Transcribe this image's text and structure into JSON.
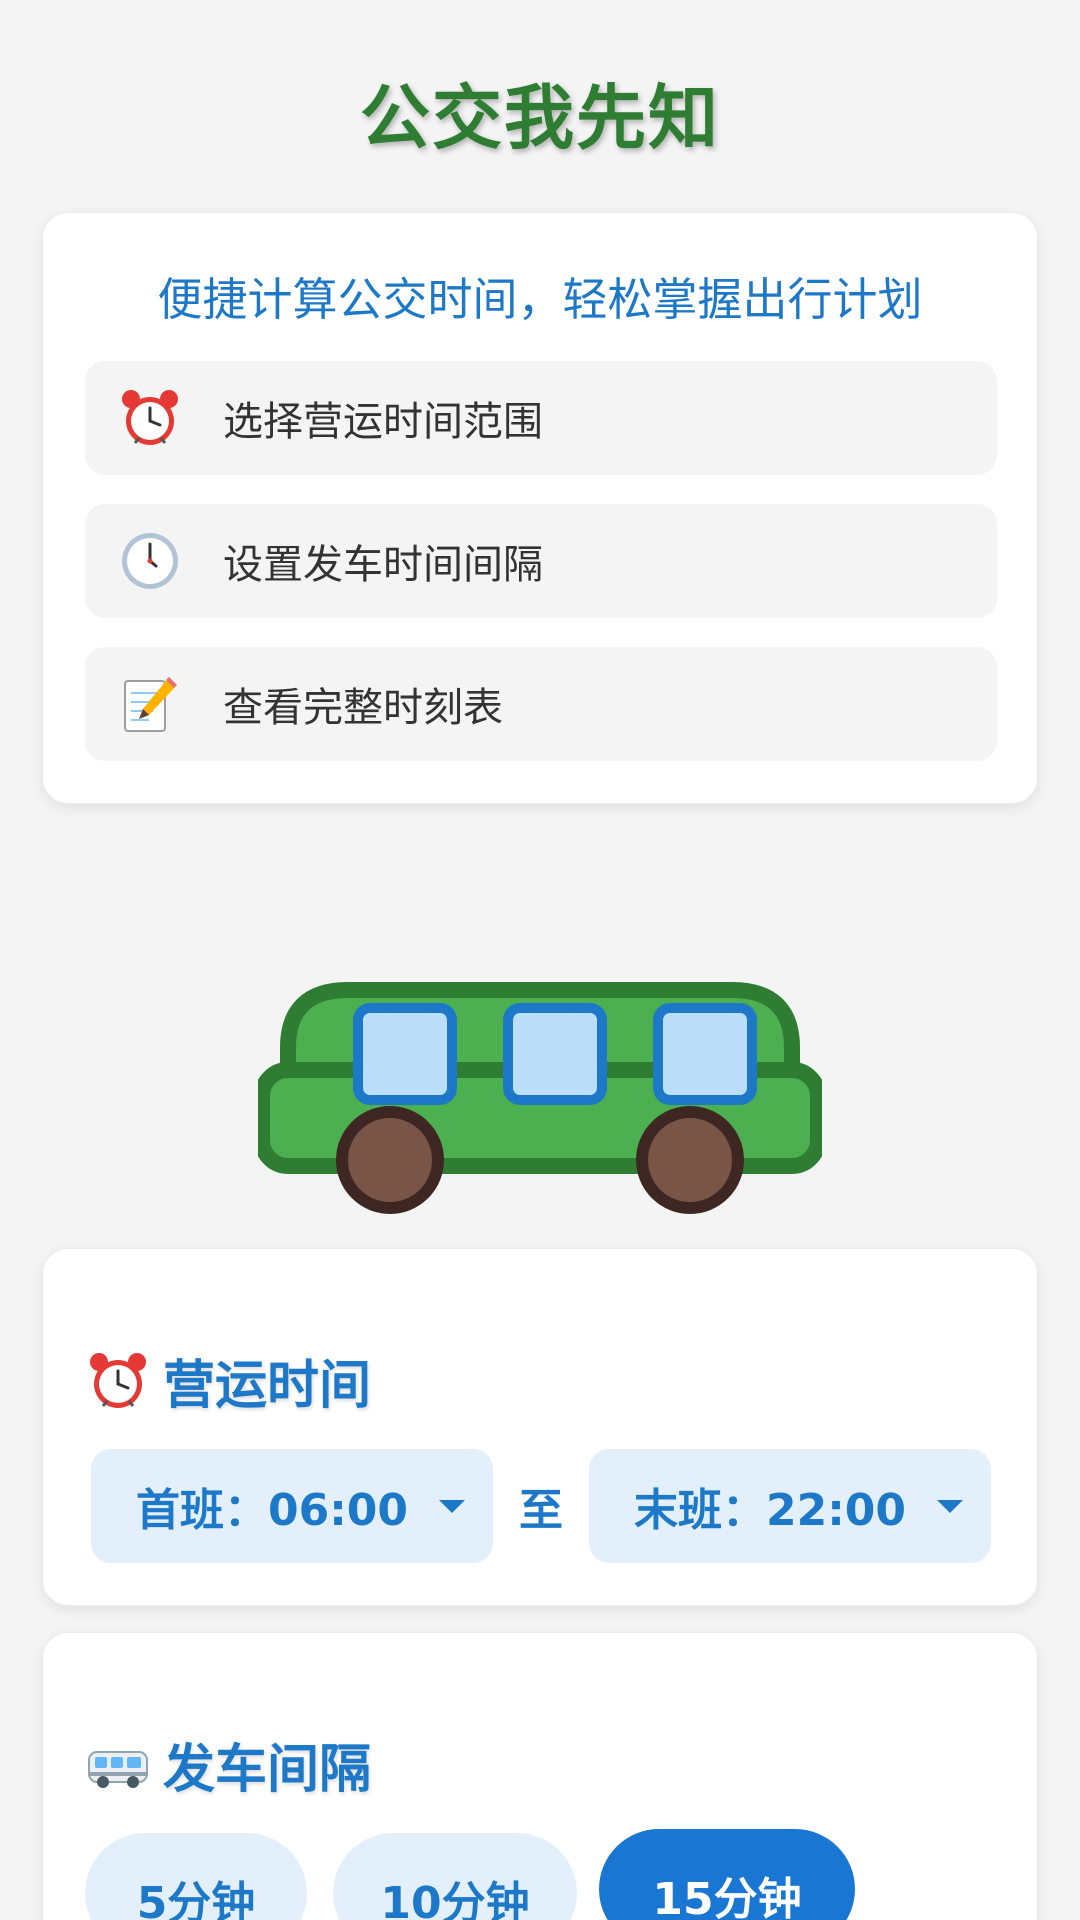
{
  "app": {
    "title": "公交我先知"
  },
  "intro": {
    "subtitle": "便捷计算公交时间，轻松掌握出行计划",
    "features": [
      {
        "icon": "alarm-clock-icon",
        "label": "选择营运时间范围"
      },
      {
        "icon": "clock-icon",
        "label": "设置发车时间间隔"
      },
      {
        "icon": "memo-icon",
        "label": "查看完整时刻表"
      }
    ]
  },
  "schedule": {
    "title": "营运时间",
    "icon": "alarm-clock-icon",
    "first_label": "首班：06:00",
    "to_label": "至",
    "last_label": "末班：22:00"
  },
  "interval": {
    "title": "发车间隔",
    "icon": "bus-icon",
    "options": [
      "5分钟",
      "10分钟",
      "15分钟"
    ],
    "selected": "15分钟"
  },
  "colors": {
    "title_green": "#2e7d32",
    "accent_blue": "#1e78c8",
    "selected_blue": "#1976d2",
    "chip_bg": "#e3f0fc",
    "bus_body": "#4caf50",
    "bus_outline": "#2e7d32"
  }
}
